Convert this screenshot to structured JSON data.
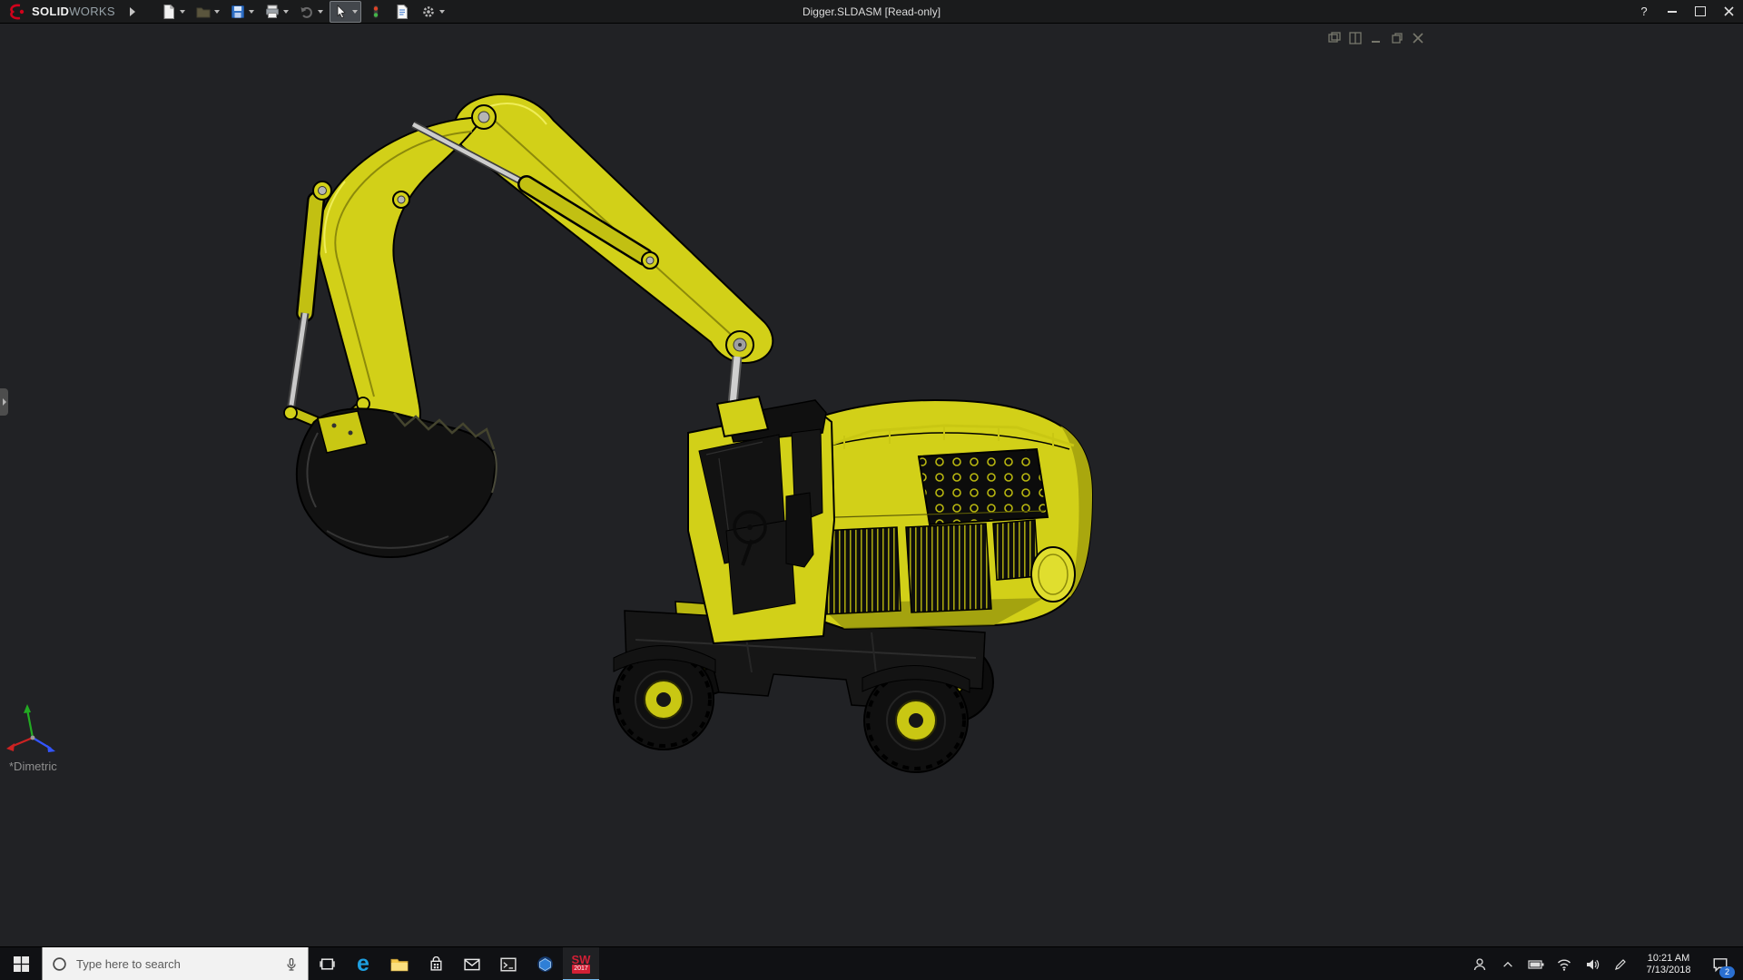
{
  "app": {
    "brand": {
      "logo": "dassault-systemes-logo",
      "name_bold": "SOLID",
      "name_light": "WORKS"
    },
    "title": "Digger.SLDASM [Read-only]",
    "toolbar": {
      "buttons": [
        {
          "name": "new-document",
          "has_dropdown": true
        },
        {
          "name": "open",
          "has_dropdown": true,
          "disabled": true
        },
        {
          "name": "save",
          "has_dropdown": true
        },
        {
          "name": "print",
          "has_dropdown": true
        },
        {
          "name": "undo",
          "has_dropdown": true,
          "disabled": true
        },
        {
          "name": "select",
          "has_dropdown": true,
          "active": true
        },
        {
          "name": "rebuild",
          "has_dropdown": false
        },
        {
          "name": "file-properties",
          "has_dropdown": false
        },
        {
          "name": "options",
          "has_dropdown": true
        }
      ]
    },
    "window_controls": {
      "help": "?",
      "minimize": "minimize",
      "maximize": "maximize",
      "close": "close"
    }
  },
  "viewport": {
    "background": "#212225",
    "view_orientation_label": "*Dimetric",
    "document_window_controls": [
      "new-window",
      "cascade-windows",
      "minimize",
      "restore",
      "close"
    ],
    "model": {
      "name": "Digger excavator assembly",
      "body_color": "#d2d018",
      "shadow_color": "#8c8a0b",
      "detail_color": "#121212",
      "hydraulic_color": "#c9c9c9"
    },
    "triad_colors": {
      "x": "#cc2222",
      "y": "#22aa22",
      "z": "#3355ff"
    }
  },
  "taskbar": {
    "start": "start-button",
    "search": {
      "placeholder": "Type here to search"
    },
    "edge_glyph": "e",
    "apps": [
      "task-view",
      "edge",
      "file-explorer",
      "store",
      "mail",
      "console",
      "blue-cube-app",
      "solidworks-2017"
    ],
    "solidworks": {
      "label": "SW",
      "year": "2017"
    },
    "tray": {
      "icons": [
        "people",
        "chevron-up",
        "battery",
        "network",
        "volume",
        "pen"
      ],
      "notification_badge": "2"
    },
    "clock": {
      "time": "10:21 AM",
      "date": "7/13/2018"
    }
  }
}
